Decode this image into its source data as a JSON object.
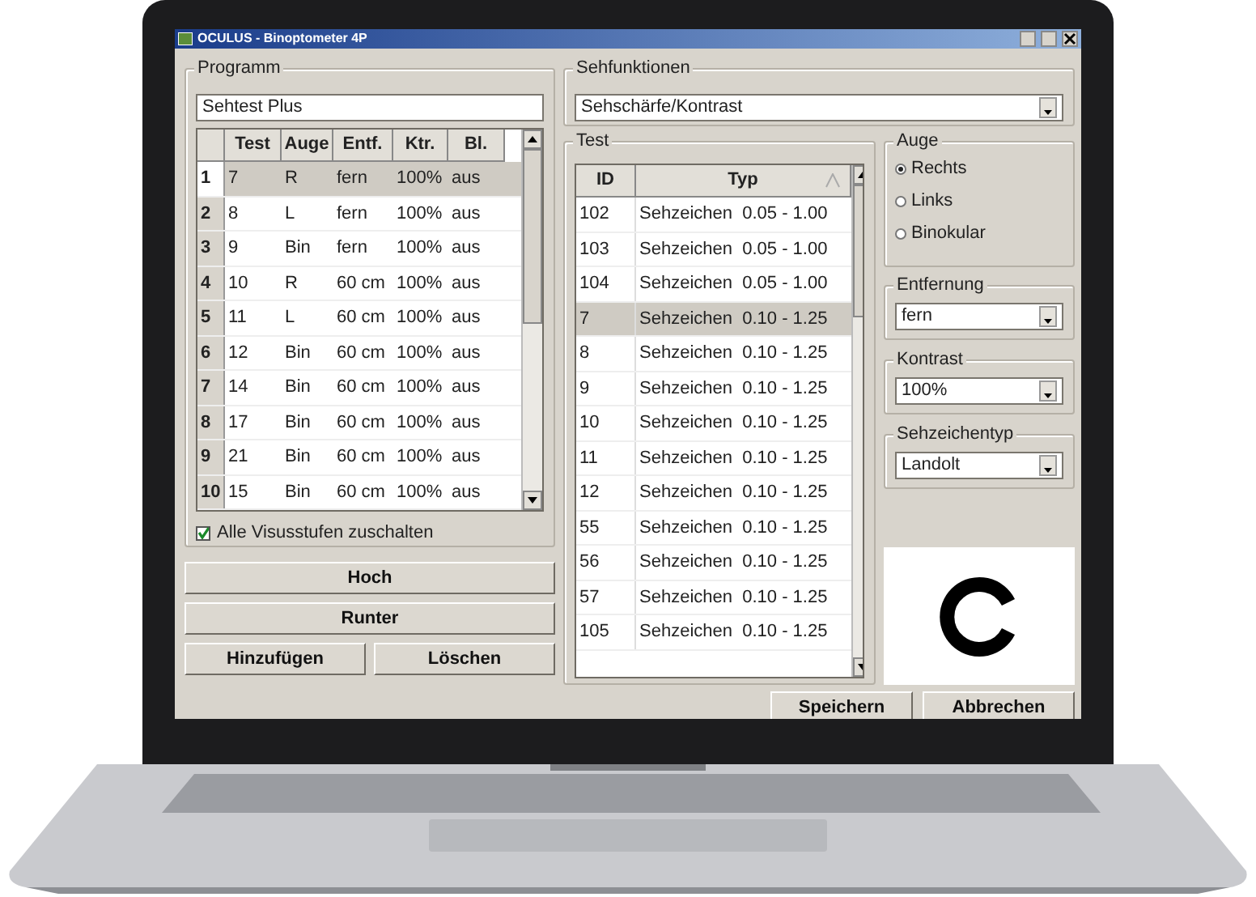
{
  "window": {
    "title": "OCULUS - Binoptometer 4P"
  },
  "programm": {
    "title": "Programm",
    "name_value": "Sehtest Plus",
    "columns": [
      "Test",
      "Auge",
      "Entf.",
      "Ktr.",
      "Bl."
    ],
    "rows": [
      {
        "number": "1",
        "cells": [
          "7",
          "R",
          "fern",
          "100%",
          "aus"
        ],
        "selected": true
      },
      {
        "number": "2",
        "cells": [
          "8",
          "L",
          "fern",
          "100%",
          "aus"
        ],
        "selected": false
      },
      {
        "number": "3",
        "cells": [
          "9",
          "Bin",
          "fern",
          "100%",
          "aus"
        ],
        "selected": false
      },
      {
        "number": "4",
        "cells": [
          "10",
          "R",
          "60 cm",
          "100%",
          "aus"
        ],
        "selected": false
      },
      {
        "number": "5",
        "cells": [
          "11",
          "L",
          "60 cm",
          "100%",
          "aus"
        ],
        "selected": false
      },
      {
        "number": "6",
        "cells": [
          "12",
          "Bin",
          "60 cm",
          "100%",
          "aus"
        ],
        "selected": false
      },
      {
        "number": "7",
        "cells": [
          "14",
          "Bin",
          "60 cm",
          "100%",
          "aus"
        ],
        "selected": false
      },
      {
        "number": "8",
        "cells": [
          "17",
          "Bin",
          "60 cm",
          "100%",
          "aus"
        ],
        "selected": false
      },
      {
        "number": "9",
        "cells": [
          "21",
          "Bin",
          "60 cm",
          "100%",
          "aus"
        ],
        "selected": false
      },
      {
        "number": "10",
        "cells": [
          "15",
          "Bin",
          "60 cm",
          "100%",
          "aus"
        ],
        "selected": false
      }
    ],
    "option": {
      "label": "Alle Visusstufen zuschalten",
      "checked": true
    }
  },
  "program_buttons": [
    {
      "label": "Hoch",
      "kind": "wide"
    },
    {
      "label": "Runter",
      "kind": "wide"
    },
    {
      "label": "Hinzufügen",
      "kind": "half"
    },
    {
      "label": "Löschen",
      "kind": "half"
    }
  ],
  "sehfunktionen": {
    "title": "Sehfunktionen",
    "value": "Sehschärfe/Kontrast"
  },
  "test": {
    "title": "Test",
    "columns": [
      "ID",
      "Typ"
    ],
    "rows": [
      {
        "id": "102",
        "typ": "Sehzeichen  0.05 - 1.00",
        "selected": false
      },
      {
        "id": "103",
        "typ": "Sehzeichen  0.05 - 1.00",
        "selected": false
      },
      {
        "id": "104",
        "typ": "Sehzeichen  0.05 - 1.00",
        "selected": false
      },
      {
        "id": "7",
        "typ": "Sehzeichen  0.10 - 1.25",
        "selected": true
      },
      {
        "id": "8",
        "typ": "Sehzeichen  0.10 - 1.25",
        "selected": false
      },
      {
        "id": "9",
        "typ": "Sehzeichen  0.10 - 1.25",
        "selected": false
      },
      {
        "id": "10",
        "typ": "Sehzeichen  0.10 - 1.25",
        "selected": false
      },
      {
        "id": "11",
        "typ": "Sehzeichen  0.10 - 1.25",
        "selected": false
      },
      {
        "id": "12",
        "typ": "Sehzeichen  0.10 - 1.25",
        "selected": false
      },
      {
        "id": "55",
        "typ": "Sehzeichen  0.10 - 1.25",
        "selected": false
      },
      {
        "id": "56",
        "typ": "Sehzeichen  0.10 - 1.25",
        "selected": false
      },
      {
        "id": "57",
        "typ": "Sehzeichen  0.10 - 1.25",
        "selected": false
      },
      {
        "id": "105",
        "typ": "Sehzeichen  0.10 - 1.25",
        "selected": false
      }
    ]
  },
  "auge": {
    "title": "Auge",
    "options": [
      {
        "label": "Rechts",
        "selected": true
      },
      {
        "label": "Links",
        "selected": false
      },
      {
        "label": "Binokular",
        "selected": false
      }
    ]
  },
  "dropdowns": [
    {
      "title": "Entfernung",
      "value": "fern"
    },
    {
      "title": "Kontrast",
      "value": "100%"
    },
    {
      "title": "Sehzeichentyp",
      "value": "Landolt"
    }
  ],
  "footer_buttons": [
    "Speichern",
    "Abbrechen"
  ]
}
